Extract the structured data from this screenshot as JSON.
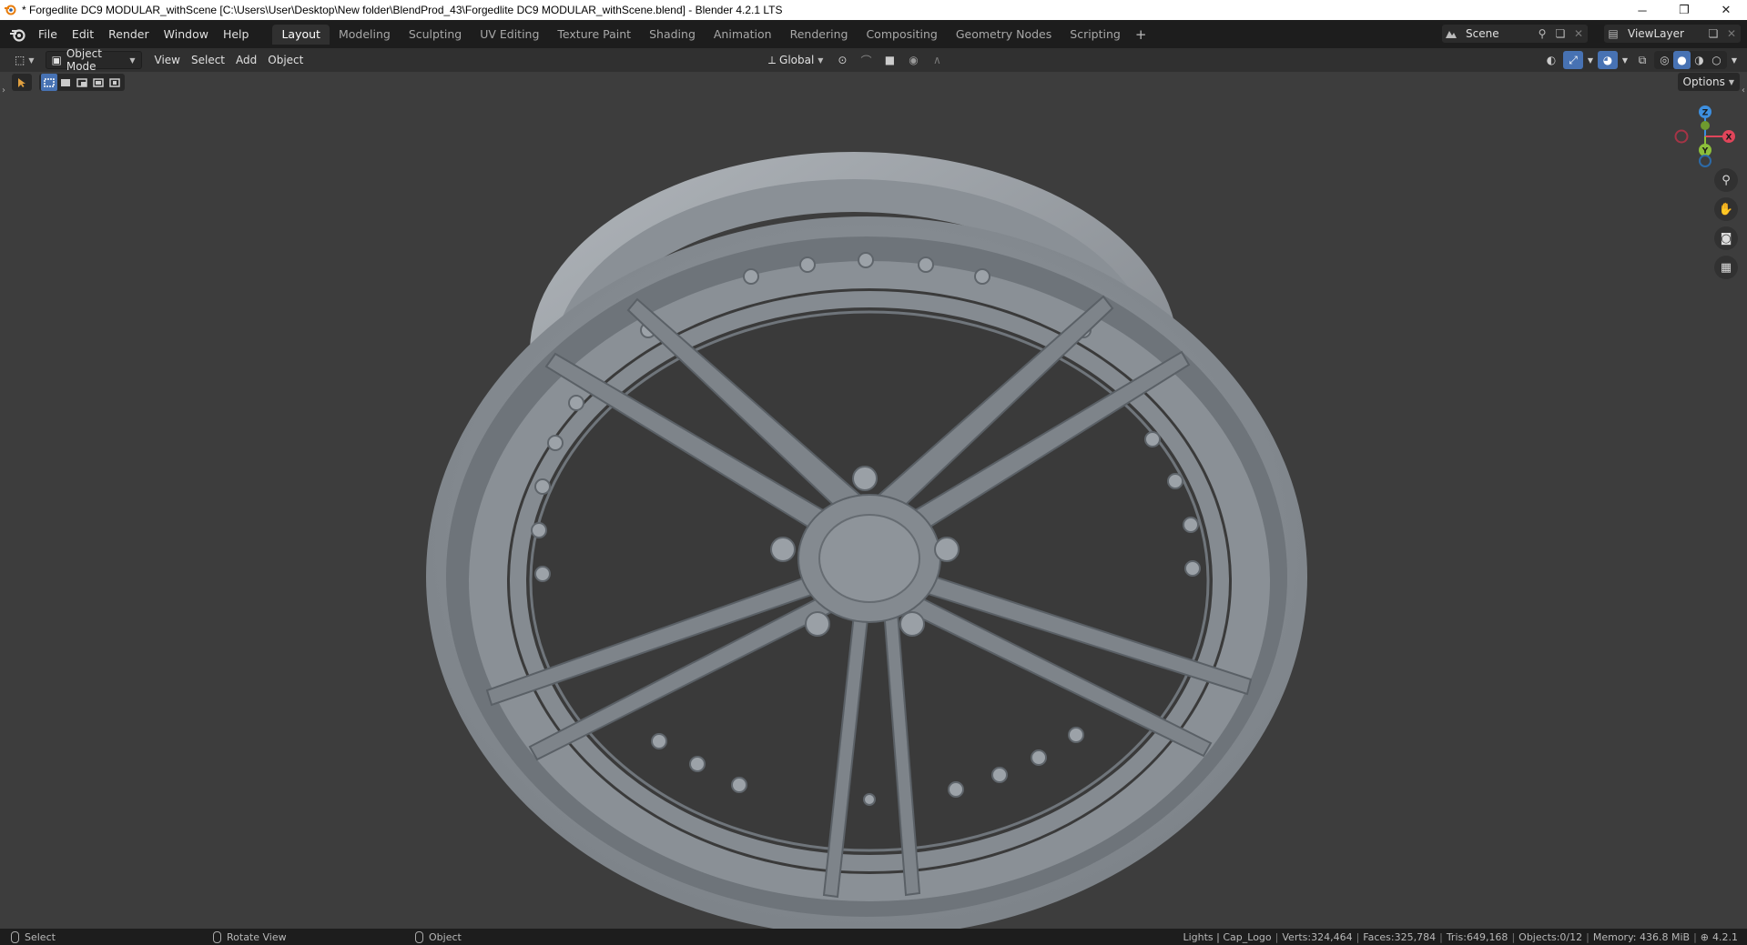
{
  "window": {
    "title": "* Forgedlite DC9 MODULAR_withScene [C:\\Users\\User\\Desktop\\New folder\\BlendProd_43\\Forgedlite DC9 MODULAR_withScene.blend] - Blender 4.2.1 LTS",
    "controls": {
      "minimize": "─",
      "maximize": "❐",
      "close": "✕"
    }
  },
  "menubar": {
    "menus": [
      "File",
      "Edit",
      "Render",
      "Window",
      "Help"
    ],
    "workspaces": [
      "Layout",
      "Modeling",
      "Sculpting",
      "UV Editing",
      "Texture Paint",
      "Shading",
      "Animation",
      "Rendering",
      "Compositing",
      "Geometry Nodes",
      "Scripting"
    ],
    "active_workspace": "Layout",
    "add_workspace": "+",
    "scene": "Scene",
    "view_layer": "ViewLayer"
  },
  "viewport_header": {
    "mode": "Object Mode",
    "menus": [
      "View",
      "Select",
      "Add",
      "Object"
    ],
    "transform_orientation": "Global",
    "options_label": "Options"
  },
  "gizmo": {
    "z": "Z",
    "y": "Y",
    "x": "X"
  },
  "statusbar": {
    "hints": [
      {
        "label": "Select"
      },
      {
        "label": "Rotate View"
      },
      {
        "label": "Object"
      }
    ],
    "stats": {
      "collection": "Lights | Cap_Logo",
      "verts": "Verts:324,464",
      "faces": "Faces:325,784",
      "tris": "Tris:649,168",
      "objects": "Objects:0/12",
      "memory": "Memory: 436.8 MiB",
      "version": "4.2.1"
    }
  },
  "colors": {
    "accent": "#4772b3",
    "header_bg": "#1d1d1d",
    "viewport_bg": "#3d3d3d",
    "model_gray": "#8f959b",
    "axis_x": "#e0455a",
    "axis_y": "#8cbf3a",
    "axis_z": "#3d8fe0"
  }
}
